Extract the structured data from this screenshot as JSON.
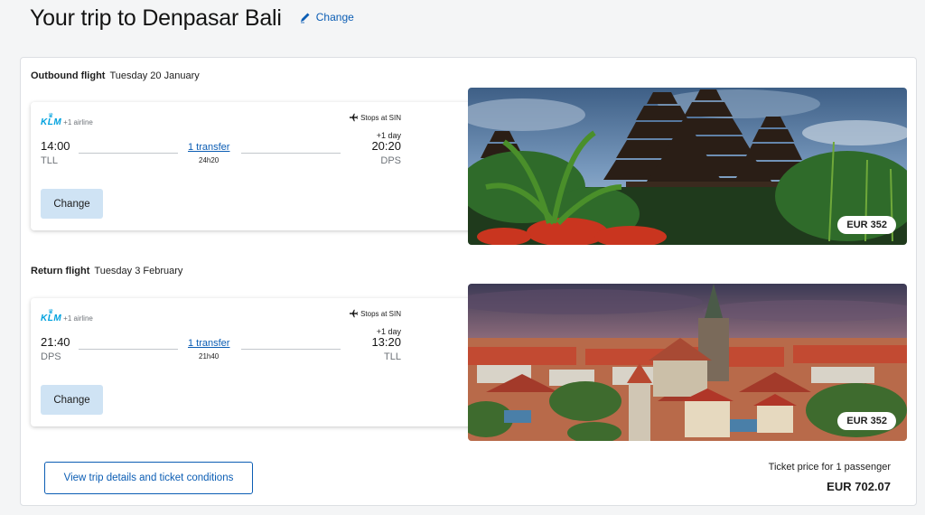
{
  "header": {
    "title": "Your trip to Denpasar Bali",
    "edit_label": "Change"
  },
  "outbound": {
    "heading": "Outbound flight",
    "date": "Tuesday 20 January",
    "airline_logo": "KLM",
    "airline_extra": "+1 airline",
    "stops": "Stops at SIN",
    "dep_time": "14:00",
    "dep_code": "TLL",
    "arr_time": "20:20",
    "arr_code": "DPS",
    "plus_day": "+1 day",
    "transfer": "1 transfer",
    "duration": "24h20",
    "change_label": "Change",
    "price": "EUR 352"
  },
  "return": {
    "heading": "Return flight",
    "date": "Tuesday 3 February",
    "airline_logo": "KLM",
    "airline_extra": "+1 airline",
    "stops": "Stops at SIN",
    "dep_time": "21:40",
    "dep_code": "DPS",
    "arr_time": "13:20",
    "arr_code": "TLL",
    "plus_day": "+1 day",
    "transfer": "1 transfer",
    "duration": "21h40",
    "change_label": "Change",
    "price": "EUR 352"
  },
  "footer": {
    "details_label": "View trip details and ticket conditions",
    "ticket_label": "Ticket price for 1 passenger",
    "total": "EUR 702.07"
  },
  "colors": {
    "accent": "#0b5db4",
    "klm": "#00a1de",
    "change_button": "#cfe3f4"
  }
}
